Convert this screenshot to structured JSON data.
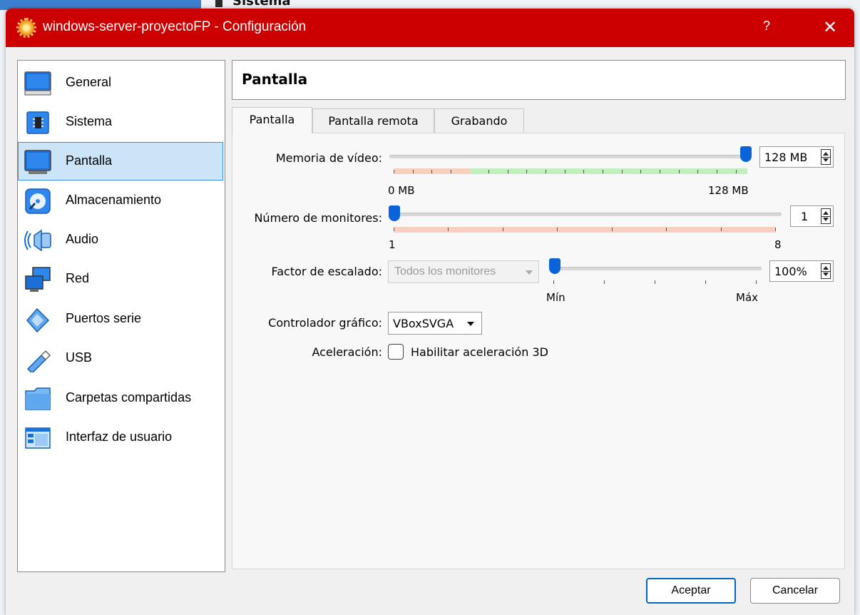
{
  "background": {
    "partial_title": "Sistema"
  },
  "window": {
    "title": "windows-server-proyectoFP - Configuración",
    "help_label": "?",
    "close_label": "✕",
    "accent": "#cc0000"
  },
  "sidebar": {
    "items": [
      {
        "label": "General",
        "icon": "general-monitor-icon"
      },
      {
        "label": "Sistema",
        "icon": "system-chip-icon"
      },
      {
        "label": "Pantalla",
        "icon": "display-monitor-icon",
        "selected": true
      },
      {
        "label": "Almacenamiento",
        "icon": "storage-disk-icon"
      },
      {
        "label": "Audio",
        "icon": "speaker-icon"
      },
      {
        "label": "Red",
        "icon": "network-icon"
      },
      {
        "label": "Puertos serie",
        "icon": "serial-port-icon"
      },
      {
        "label": "USB",
        "icon": "usb-icon"
      },
      {
        "label": "Carpetas compartidas",
        "icon": "shared-folder-icon"
      },
      {
        "label": "Interfaz de usuario",
        "icon": "user-interface-icon"
      }
    ]
  },
  "page": {
    "title": "Pantalla"
  },
  "tabs": [
    {
      "label": "Pantalla",
      "active": true
    },
    {
      "label": "Pantalla remota"
    },
    {
      "label": "Grabando"
    }
  ],
  "screen": {
    "video_memory": {
      "label": "Memoria de vídeo:",
      "value": "128 MB",
      "level": 1.0,
      "min_label": "0 MB",
      "max_label": "128 MB"
    },
    "monitors": {
      "label": "Número de monitores:",
      "value": "1",
      "level": 0.0,
      "min_label": "1",
      "max_label": "8"
    },
    "scaling": {
      "label": "Factor de escalado:",
      "combo_value": "Todos los monitores",
      "value": "100%",
      "level": 0.0,
      "min_label": "Mín",
      "max_label": "Máx"
    },
    "controller": {
      "label": "Controlador gráfico:",
      "value": "VBoxSVGA"
    },
    "acceleration": {
      "label": "Aceleración:",
      "checkbox_label": "Habilitar aceleración 3D",
      "checked": false
    }
  },
  "footer": {
    "ok_label": "Aceptar",
    "cancel_label": "Cancelar"
  },
  "colors": {
    "selection": "#cce4f7",
    "thumb": "#0a63d8",
    "zone_red": "#f9cfc0",
    "zone_green": "#c2efbe"
  }
}
